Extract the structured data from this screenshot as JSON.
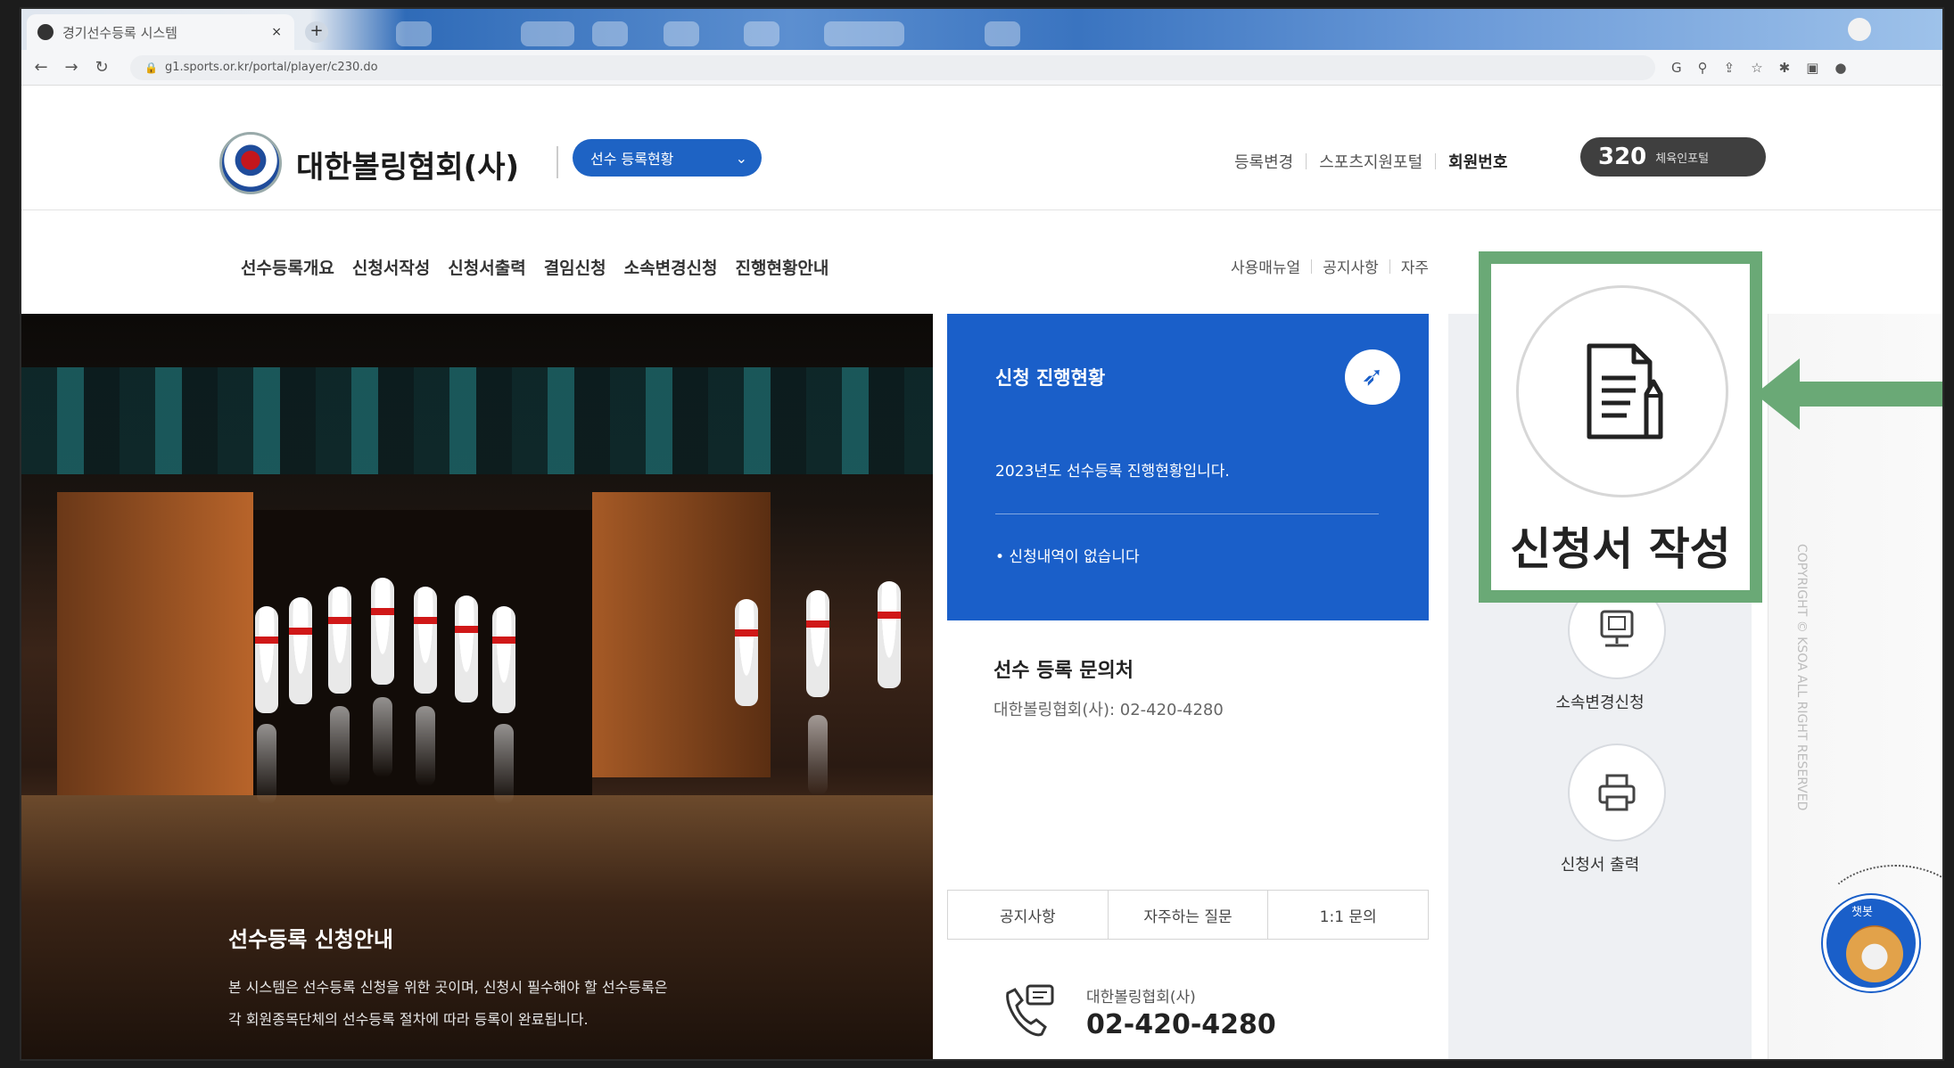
{
  "browser": {
    "tab_title": "경기선수등록 시스템",
    "tab_close": "×",
    "new_tab": "+",
    "url": "g1.sports.or.kr/portal/player/c230.do"
  },
  "header": {
    "org_name": "대한볼링협회(사)",
    "player_select": "선수 등록현황",
    "links": [
      "등록변경",
      "스포츠지원포털"
    ],
    "member_label": "회원번호",
    "member_number": "320",
    "member_sub": "체육인포털"
  },
  "nav": {
    "main": [
      "선수등록개요",
      "신청서작성",
      "신청서출력",
      "결임신청",
      "소속변경신청",
      "진행현황안내"
    ],
    "right": [
      "사용매뉴얼",
      "공지사항",
      "자주"
    ]
  },
  "hero": {
    "title": "선수등록 신청안내",
    "desc_line1": "본 시스템은 선수등록 신청을 위한 곳이며, 신청시 필수해야 할 선수등록은",
    "desc_line2": "각 회원종목단체의 선수등록 절차에 따라 등록이 완료됩니다."
  },
  "status_card": {
    "title": "신청 진행현황",
    "year_text": "2023년도 선수등록 진행현황입니다.",
    "empty_text": "• 신청내역이 없습니다"
  },
  "contact": {
    "title": "선수 등록 문의처",
    "detail": "대한볼링협회(사): 02-420-4280",
    "tabs": [
      "공지사항",
      "자주하는 질문",
      "1:1 문의"
    ],
    "phone_org": "대한볼링협회(사)",
    "phone_number": "02-420-4280"
  },
  "quick_menu": {
    "change_label": "소속변경신청",
    "print_label": "신청서 출력"
  },
  "highlight": {
    "label": "신청서 작성"
  },
  "copyright": "COPYRIGHT © KSOA ALL RIGHT RESERVED",
  "chatbot": {
    "label": "챗봇"
  },
  "colors": {
    "primary_blue": "#1a5fc9",
    "highlight_green": "#6aa976",
    "dark_pill": "#3f3f3f"
  }
}
